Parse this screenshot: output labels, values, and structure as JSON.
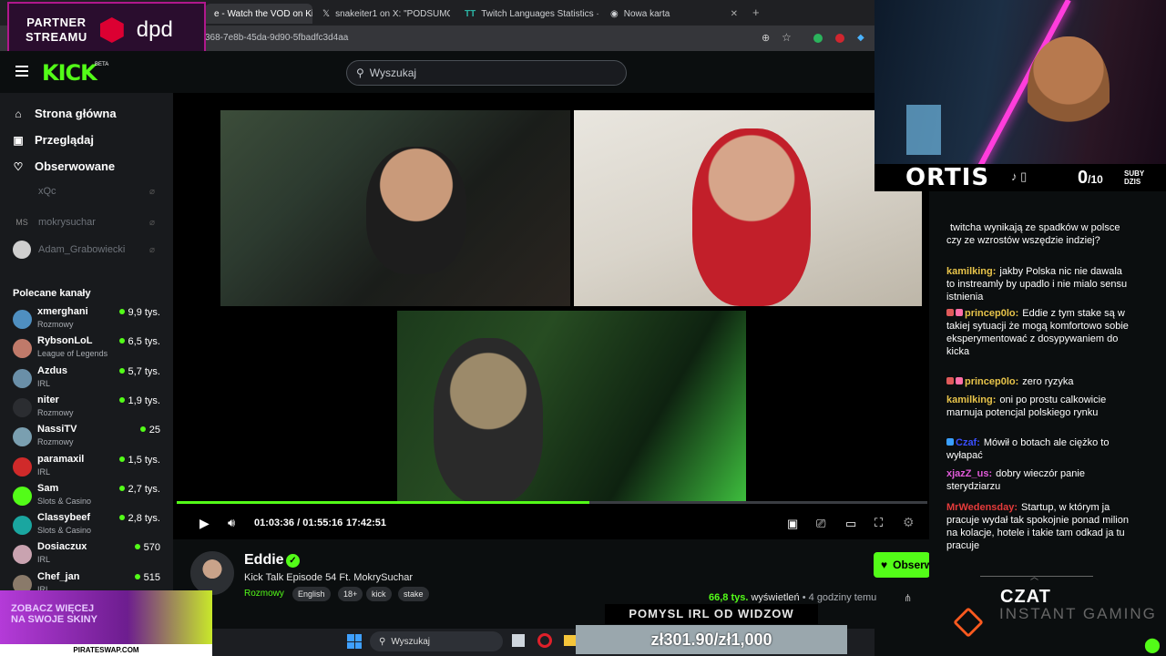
{
  "partner": {
    "line1": "PARTNER",
    "line2": "STREAMU",
    "brand": "dpd"
  },
  "browser": {
    "tabs": [
      {
        "label": "e - Watch the VOD on Kick",
        "active": true
      },
      {
        "label": "snakeiter1 on X: \"PODSUMOW",
        "active": false
      },
      {
        "label": "Twitch Languages Statistics · Tw",
        "active": false
      },
      {
        "label": "Nowa karta",
        "active": false
      }
    ],
    "url": "368-7e8b-45da-9d90-5fbadfc3d4aa",
    "new_tab": "+"
  },
  "kick": {
    "logo": "KICK",
    "beta": "BETA",
    "search_placeholder": "Wyszukaj"
  },
  "sidebar": {
    "nav": [
      {
        "label": "Strona główna",
        "icon": "home-icon"
      },
      {
        "label": "Przeglądaj",
        "icon": "browse-icon"
      },
      {
        "label": "Obserwowane",
        "icon": "heart-icon"
      }
    ],
    "following": [
      {
        "name": "xQc",
        "initials": ""
      },
      {
        "name": "mokrysuchar",
        "initials": "MS"
      },
      {
        "name": "Adam_Grabowiecki",
        "initials": ""
      }
    ],
    "recommended_title": "Polecane kanały",
    "recommended": [
      {
        "name": "xmerghani",
        "category": "Rozmowy",
        "viewers": "9,9 tys.",
        "color": "#4f8fc0"
      },
      {
        "name": "RybsonLoL",
        "category": "League of Legends",
        "viewers": "6,5 tys.",
        "color": "#c07a6a"
      },
      {
        "name": "Azdus",
        "category": "IRL",
        "viewers": "5,7 tys.",
        "color": "#6a8fa8"
      },
      {
        "name": "niter",
        "category": "Rozmowy",
        "viewers": "1,9 tys.",
        "color": "#2b2d31"
      },
      {
        "name": "NassiTV",
        "category": "Rozmowy",
        "viewers": "25",
        "color": "#7a9fb0"
      },
      {
        "name": "paramaxil",
        "category": "IRL",
        "viewers": "1,5 tys.",
        "color": "#d02a2a"
      },
      {
        "name": "Sam",
        "category": "Slots & Casino",
        "viewers": "2,7 tys.",
        "color": "#53fc18"
      },
      {
        "name": "Classybeef",
        "category": "Slots & Casino",
        "viewers": "2,8 tys.",
        "color": "#1aa6a0"
      },
      {
        "name": "Dosiaczux",
        "category": "IRL",
        "viewers": "570",
        "color": "#c9a3b0"
      },
      {
        "name": "Chef_jan",
        "category": "IRL",
        "viewers": "515",
        "color": "#8a7a6a"
      }
    ]
  },
  "player": {
    "time": "01:03:36 / 01:55:16",
    "clock": "17:42:51",
    "progress": 0.55
  },
  "channel": {
    "name": "Eddie",
    "title": "Kick Talk Episode 54 Ft. MokrySuchar",
    "category": "Rozmowy",
    "tags": [
      "English",
      "18+",
      "kick",
      "stake"
    ],
    "follow_label": "Obserwuj",
    "views": "66,8 tys.",
    "views_label": "wyświetleń",
    "ago": "• 4 godziny temu"
  },
  "overlay": {
    "streamer": "ORTIS",
    "subs_count": "0",
    "subs_goal": "/10",
    "subs_label_1": "SUBY",
    "subs_label_2": "DZIS"
  },
  "chat": {
    "messages": [
      {
        "user": "",
        "text": "twitcha wynikają ze spadków w polsce czy ze wzrostów wszędzie indziej?",
        "color": "#ffffff"
      },
      {
        "user": "kamilking:",
        "text": "jakby Polska nic nie dawala to instreamly by upadlo i nie mialo sensu istnienia",
        "color": "#e8c44a"
      },
      {
        "user": "princep0lo:",
        "text": "Eddie z tym stake są w takiej sytuacji że mogą komfortowo sobie eksperymentować z dosypywaniem do kicka",
        "color": "#e8c44a"
      },
      {
        "user": "princep0lo:",
        "text": "zero ryzyka",
        "color": "#e8c44a"
      },
      {
        "user": "kamilking:",
        "text": "oni po prostu calkowicie marnuja potencjal polskiego rynku",
        "color": "#e8c44a"
      },
      {
        "user": "Czaf:",
        "text": "Mówił o botach ale ciężko to wyłapać",
        "color": "#3a4fff"
      },
      {
        "user": "xjazZ_us:",
        "text": "dobry wieczór panie sterydziarzu",
        "color": "#e05ad8"
      },
      {
        "user": "MrWedensday:",
        "text": "Startup, w którym ja pracuje wydał tak spokojnie ponad milion na kolacje, hotele i takie tam odkad ja tu pracuje",
        "color": "#e53b3b"
      }
    ],
    "footer_title": "CZAT",
    "footer_brand": "INSTANT GAMING"
  },
  "promo": {
    "text_1": "ZOBACZ WIĘCEJ",
    "text_2": "NA SWOJE SKINY",
    "url": "PIRATESWAP.COM"
  },
  "taskbar": {
    "search": "Wyszukaj"
  },
  "irl": {
    "label": "POMYSL IRL OD WIDZOW",
    "value": "zł301.90/zł1,000"
  }
}
